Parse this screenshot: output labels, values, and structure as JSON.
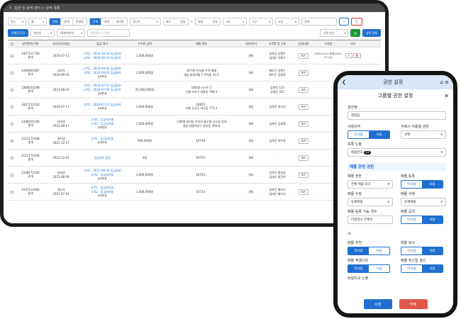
{
  "desktop": {
    "breadcrumb": "입금 및 실적 관리 > 실적 목록",
    "filters": {
      "period": "반도",
      "month": "월",
      "type_seg": [
        "전체",
        "증개",
        "컨설팅"
      ],
      "deal_seg": [
        "전체",
        "완료",
        "대기중"
      ],
      "manager": "담당자",
      "min_label": "최소",
      "min_unit": "만원",
      "max_label": "최대",
      "max_unit": "만원",
      "city": "시도",
      "district": "구군",
      "dong": "도동",
      "search_btn": "검색"
    },
    "row2": {
      "total_badge": "전체(11건)",
      "sort": "최신순",
      "page_size": "10개씩보기",
      "search_placeholder": "실적번호,고객명",
      "select_all": "선택 기능",
      "add_btn": "실적 등록"
    },
    "columns": [
      "실적번호/구분",
      "담당자/신청일",
      "입금 처리",
      "수수료 금액",
      "매물 정보",
      "영타/단타",
      "고객명 및 구분",
      "상세내용",
      "수정일",
      "비고"
    ],
    "rows": [
      {
        "no": "2407111758",
        "kind": "중개",
        "who": "",
        "date": "2024-07-11",
        "pay": [
          "고객1 : 2024-10-24 입금완료",
          "고객2 : 2024-10-24 입금완료"
        ],
        "pay_note": "",
        "fee": "1,000,000원",
        "prop": [
          "",
          ""
        ],
        "lr": "영타",
        "client": [
          "임차인 김철수",
          "임대인 이철수"
        ],
        "detail": "보기",
        "mod": "2024-10-24 등록(2024-07-11)"
      },
      {
        "no": "2409021607",
        "kind": "중개",
        "who": "김부기",
        "date": "2024-09-02",
        "pay": [
          "고객1 : 2024-09-02 입금완료",
          "고객2 : 2024-09-02 입금완료"
        ],
        "pay_note": "상세변경",
        "fee": "2,000,000원",
        "prop": [
          "16730 반지층 주택 매매",
          "경남 창원의창구 반지동 43-1"
        ],
        "lr": "영타",
        "client": [
          "매도인 김철수",
          "매수인 김영희"
        ],
        "detail": "보기",
        "mod": "-"
      },
      {
        "no": "2308102248",
        "kind": "중개",
        "who": "",
        "date": "2023-08-10",
        "pay": [
          "고객1 : 2024-07-12 입금완료",
          "고객2 : 2024-07-02 입금완료"
        ],
        "pay_note": "상세변경",
        "fee": "25,000,000원",
        "prop": [
          "16832 더스트 1",
          "서울 마포구 대흥동 766-2"
        ],
        "lr": "영타",
        "client": [
          "임차인 123",
          "임대인 321"
        ],
        "detail": "보기",
        "mod": "-"
      },
      {
        "no": "2407111516",
        "kind": "중개",
        "who": "",
        "date": "2024-07-11",
        "pay": [
          "고객1 : 2024-07-11 입금완료",
          ""
        ],
        "pay_note": "상세변경",
        "fee": "5,000,000원",
        "prop": [
          "16855 -",
          "서울 강서구 마곡동 771-3"
        ],
        "lr": "영타",
        "client": [
          "임차인 박기사",
          ""
        ],
        "detail": "보기",
        "mod": "-"
      },
      {
        "no": "2308101240",
        "kind": "중개",
        "who": "성태생",
        "date": "2023-08-17",
        "pay": [
          "고객1 : 입금대기중",
          "고객2 : 입금대기중"
        ],
        "pay_note": "상세변경",
        "fee": "2,000,000원",
        "prop": [
          "13056 영사동 루터리 중소형 사무실 임대",
          "경남 창원의창구 명서동 299-8"
        ],
        "lr": "영타",
        "client": [
          "임차인 김생명",
          ""
        ],
        "detail": "보기",
        "mod": "-"
      },
      {
        "no": "2112171638",
        "kind": "중개",
        "who": "정우생",
        "date": "2021-12-17",
        "pay": [
          "고객1 : 입금대기중",
          ""
        ],
        "pay_note": "상세변경",
        "fee": "600,000원",
        "prop": [
          "16739 -",
          ""
        ],
        "lr": "영타",
        "client": [
          "임차인 박수정",
          ""
        ],
        "detail": "보기",
        "mod": "-"
      },
      {
        "no": "2112171024",
        "kind": "중개",
        "who": "",
        "date": "2021-12-01",
        "pay": [
          "입금정보 없음",
          ""
        ],
        "pay_note": "",
        "fee": "0원",
        "prop": [
          "16735 -",
          ""
        ],
        "lr": "영타",
        "client": [
          "-",
          ""
        ],
        "detail": "보기",
        "mod": "-"
      },
      {
        "no": "2108171520",
        "kind": "중개",
        "who": "성태생",
        "date": "2021-08-29",
        "pay": [
          "고객1 : 2021-08-30 입금완료",
          "고객2 : 입금대기중"
        ],
        "pay_note": "상세변경",
        "fee": "2,000,000원",
        "prop": [
          "16720 -",
          ""
        ],
        "lr": "영타",
        "client": [
          "임차인 홍길동",
          "임대인 홍진희"
        ],
        "detail": "보기",
        "mod": "-"
      },
      {
        "no": "2107131836",
        "kind": "중개",
        "who": "강부기",
        "date": "2021-07-01",
        "pay": [
          "고객1 : 입금대기중",
          "고객2 : 입금대기중"
        ],
        "pay_note": "상세변경",
        "fee": "1,000,000원",
        "prop": [
          "16714 -",
          ""
        ],
        "lr": "영타",
        "client": [
          "임차인 매도인",
          "임대인 매도인"
        ],
        "detail": "보기",
        "mod": "-"
      }
    ]
  },
  "phone": {
    "header_title": "권한 설정",
    "modal_title": "그룹별 권한 설정",
    "auth_name_label": "권한명",
    "auth_name_value": "영업팀",
    "use_label": "사용유무",
    "delete_label": "삭제시 이동될 권한",
    "seg_off": "미사용",
    "seg_on": "사용",
    "select_label": "선택",
    "list_expose_label": "목록 노출",
    "list_expose_value": "매물번호",
    "list_expose_count": "12",
    "section_title": "매물 관련 권한",
    "perms": [
      {
        "left": "매물 권한",
        "left_value": "전체 매물 보기",
        "right": "매물 등록"
      },
      {
        "left": "매물 수정",
        "left_value": "등록매물",
        "right": "매물 삭제",
        "right_value": "등록매물"
      },
      {
        "left": "매물 등록 가능 갯수",
        "left_value": "미입력시 무제한",
        "left_unit": "개",
        "right": "매물 공개"
      },
      {
        "left": "매물 추천",
        "right": "매물 복사"
      },
      {
        "left": "매물 엑셀다운",
        "right": "매물 최신일 갱신"
      }
    ],
    "more_label": "비밀비교 노출",
    "save_btn": "수정",
    "delete_btn": "삭제",
    "colors": {
      "accent": "#1f6fd1",
      "danger": "#e2574c",
      "header": "#d9e6f6"
    }
  }
}
